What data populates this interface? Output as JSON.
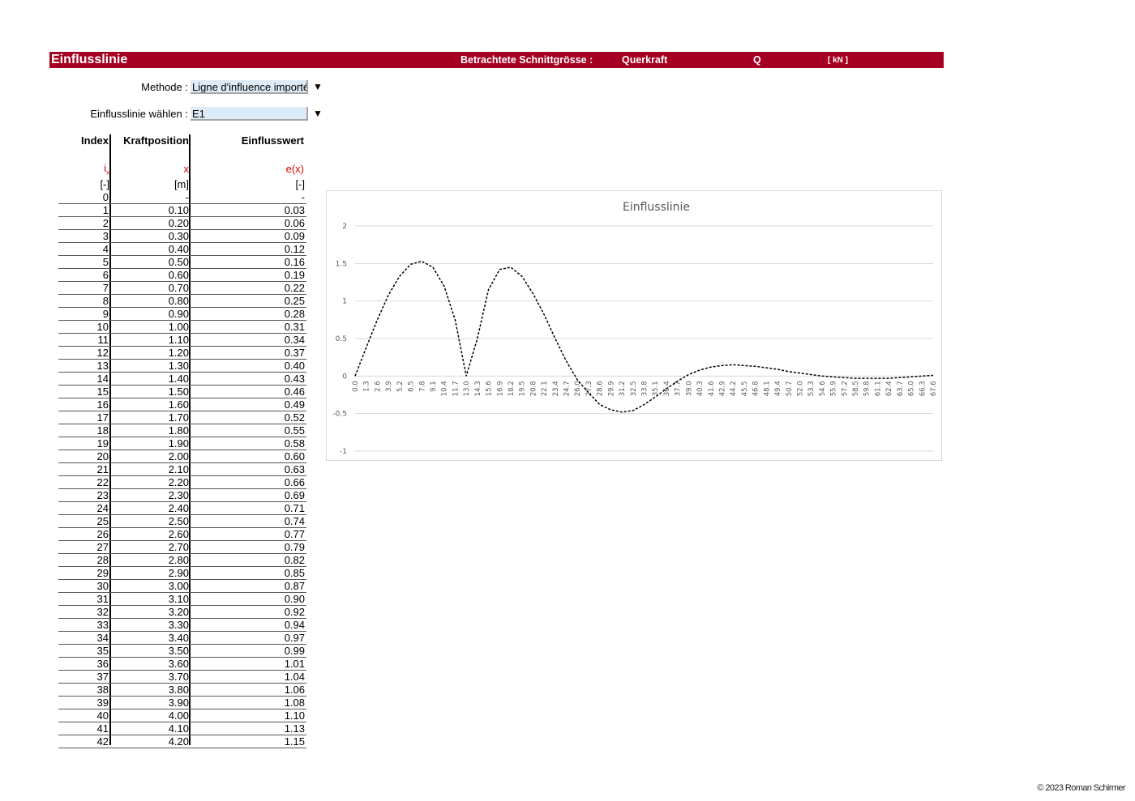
{
  "header": {
    "title": "Einflusslinie",
    "section_label": "Betrachtete Schnittgrösse :",
    "section_value": "Querkraft",
    "symbol": "Q",
    "unit": "[ kN ]"
  },
  "controls": {
    "method_label": "Methode :",
    "method_value": "Ligne d'influence importée",
    "line_label": "Einflusslinie wählen :",
    "line_value": "E1",
    "dropdown_glyph": "▼"
  },
  "table": {
    "headers": [
      "Index",
      "Kraftposition",
      "Einflusswert"
    ],
    "symbols": {
      "index_main": "i",
      "index_sub": "x",
      "position": "x",
      "value": "e(x)"
    },
    "units": [
      "[-]",
      "[m]",
      "[-]"
    ],
    "rows": [
      [
        "0",
        "-",
        "-"
      ],
      [
        "1",
        "0.10",
        "0.03"
      ],
      [
        "2",
        "0.20",
        "0.06"
      ],
      [
        "3",
        "0.30",
        "0.09"
      ],
      [
        "4",
        "0.40",
        "0.12"
      ],
      [
        "5",
        "0.50",
        "0.16"
      ],
      [
        "6",
        "0.60",
        "0.19"
      ],
      [
        "7",
        "0.70",
        "0.22"
      ],
      [
        "8",
        "0.80",
        "0.25"
      ],
      [
        "9",
        "0.90",
        "0.28"
      ],
      [
        "10",
        "1.00",
        "0.31"
      ],
      [
        "11",
        "1.10",
        "0.34"
      ],
      [
        "12",
        "1.20",
        "0.37"
      ],
      [
        "13",
        "1.30",
        "0.40"
      ],
      [
        "14",
        "1.40",
        "0.43"
      ],
      [
        "15",
        "1.50",
        "0.46"
      ],
      [
        "16",
        "1.60",
        "0.49"
      ],
      [
        "17",
        "1.70",
        "0.52"
      ],
      [
        "18",
        "1.80",
        "0.55"
      ],
      [
        "19",
        "1.90",
        "0.58"
      ],
      [
        "20",
        "2.00",
        "0.60"
      ],
      [
        "21",
        "2.10",
        "0.63"
      ],
      [
        "22",
        "2.20",
        "0.66"
      ],
      [
        "23",
        "2.30",
        "0.69"
      ],
      [
        "24",
        "2.40",
        "0.71"
      ],
      [
        "25",
        "2.50",
        "0.74"
      ],
      [
        "26",
        "2.60",
        "0.77"
      ],
      [
        "27",
        "2.70",
        "0.79"
      ],
      [
        "28",
        "2.80",
        "0.82"
      ],
      [
        "29",
        "2.90",
        "0.85"
      ],
      [
        "30",
        "3.00",
        "0.87"
      ],
      [
        "31",
        "3.10",
        "0.90"
      ],
      [
        "32",
        "3.20",
        "0.92"
      ],
      [
        "33",
        "3.30",
        "0.94"
      ],
      [
        "34",
        "3.40",
        "0.97"
      ],
      [
        "35",
        "3.50",
        "0.99"
      ],
      [
        "36",
        "3.60",
        "1.01"
      ],
      [
        "37",
        "3.70",
        "1.04"
      ],
      [
        "38",
        "3.80",
        "1.06"
      ],
      [
        "39",
        "3.90",
        "1.08"
      ],
      [
        "40",
        "4.00",
        "1.10"
      ],
      [
        "41",
        "4.10",
        "1.13"
      ],
      [
        "42",
        "4.20",
        "1.15"
      ]
    ]
  },
  "chart_data": {
    "type": "line",
    "title": "Einflusslinie",
    "xlabel": "",
    "ylabel": "",
    "ylim": [
      -1,
      2
    ],
    "yticks": [
      "2",
      "1.5",
      "1",
      "0.5",
      "0",
      "-0.5",
      "-1"
    ],
    "x_tick_labels": [
      "0.0",
      "1.3",
      "2.6",
      "3.9",
      "5.2",
      "6.5",
      "7.8",
      "9.1",
      "10.4",
      "11.7",
      "13.0",
      "14.3",
      "15.6",
      "16.9",
      "18.2",
      "19.5",
      "20.8",
      "22.1",
      "23.4",
      "24.7",
      "26.0",
      "27.3",
      "28.6",
      "29.9",
      "31.2",
      "32.5",
      "33.8",
      "35.1",
      "36.4",
      "37.7",
      "39.0",
      "40.3",
      "41.6",
      "42.9",
      "44.2",
      "45.5",
      "46.8",
      "48.1",
      "49.4",
      "50.7",
      "52.0",
      "53.3",
      "54.6",
      "55.9",
      "57.2",
      "58.5",
      "59.8",
      "61.1",
      "62.4",
      "63.7",
      "65.0",
      "66.3",
      "67.6"
    ],
    "grid": true,
    "line_style": "dashed",
    "line_color": "#000000",
    "series": [
      {
        "x": [
          0.0,
          1.3,
          2.6,
          3.9,
          5.2,
          6.5,
          7.8,
          9.1,
          10.4,
          11.7,
          13.0,
          14.3,
          15.6,
          16.9,
          18.2,
          19.5,
          20.8,
          22.1,
          23.4,
          24.7,
          26.0,
          27.3,
          28.6,
          29.9,
          31.2,
          32.5,
          33.8,
          35.1,
          36.4,
          37.7,
          39.0,
          40.3,
          41.6,
          42.9,
          44.2,
          45.5,
          46.8,
          48.1,
          49.4,
          50.7,
          52.0,
          53.3,
          54.6,
          55.9,
          57.2,
          58.5,
          59.8,
          61.1,
          62.4,
          63.7,
          65.0,
          66.3,
          67.6
        ],
        "values": [
          0.0,
          0.38,
          0.75,
          1.08,
          1.33,
          1.49,
          1.53,
          1.45,
          1.2,
          0.75,
          0.0,
          0.5,
          1.15,
          1.42,
          1.45,
          1.33,
          1.1,
          0.82,
          0.5,
          0.2,
          -0.05,
          -0.22,
          -0.38,
          -0.45,
          -0.48,
          -0.46,
          -0.38,
          -0.28,
          -0.17,
          -0.07,
          0.02,
          0.08,
          0.12,
          0.14,
          0.15,
          0.14,
          0.13,
          0.11,
          0.09,
          0.06,
          0.04,
          0.02,
          0.0,
          -0.01,
          -0.02,
          -0.03,
          -0.03,
          -0.03,
          -0.03,
          -0.02,
          -0.01,
          0.0,
          0.01
        ]
      }
    ]
  },
  "footer": "© 2023 Roman Schirmer"
}
